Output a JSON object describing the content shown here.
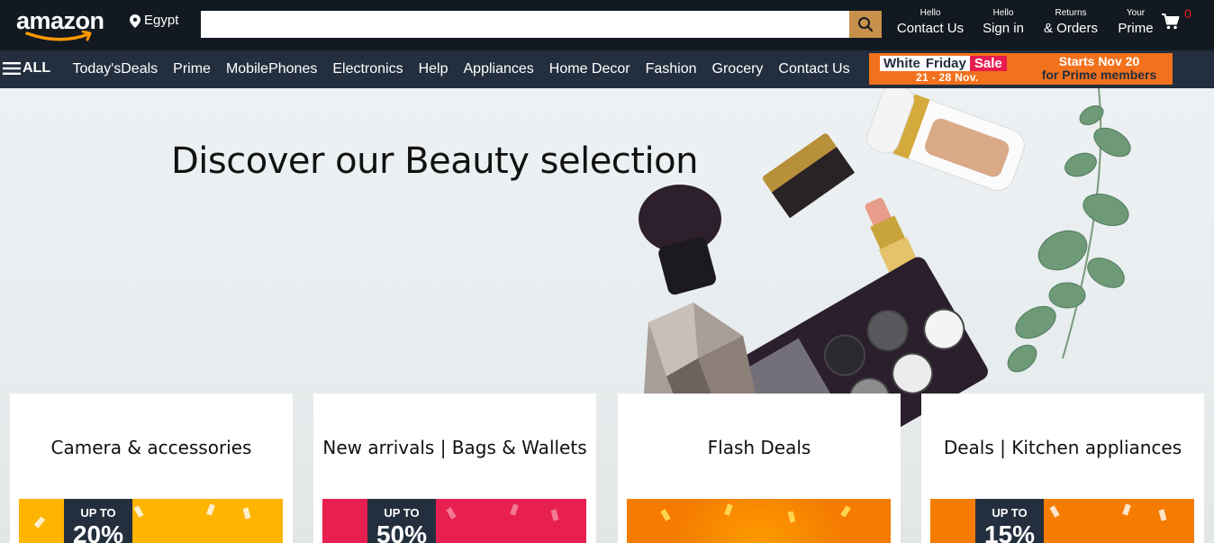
{
  "header": {
    "logo_text": "amazon",
    "location": "Egypt",
    "search": {
      "placeholder": "",
      "value": ""
    },
    "tools": [
      {
        "small": "Hello",
        "big": "Contact Us"
      },
      {
        "small": "Hello",
        "big": "Sign in"
      },
      {
        "small": "Returns",
        "big": "& Orders"
      },
      {
        "small": "Your",
        "big": "Prime"
      }
    ],
    "cart_count": "0"
  },
  "subnav": {
    "all_label": "ALL",
    "links": [
      "Today'sDeals",
      "Prime",
      "MobilePhones",
      "Electronics",
      "Help",
      "Appliances",
      "Home Decor",
      "Fashion",
      "Grocery",
      "Contact Us"
    ],
    "promo": {
      "word1": "White",
      "word2": "Friday",
      "word3": "Sale",
      "dates": "21 - 28 Nov.",
      "line1": "Starts Nov 20",
      "line2": "for Prime members"
    }
  },
  "hero": {
    "title": "Discover our Beauty selection"
  },
  "cards": [
    {
      "title": "Camera & accessories",
      "badge_top": "UP TO",
      "badge_pct": "20%",
      "color": "#ffb400"
    },
    {
      "title": "New arrivals | Bags & Wallets",
      "badge_top": "UP TO",
      "badge_pct": "50%",
      "color": "#e8204f"
    },
    {
      "title": "Flash Deals",
      "badge_top": "",
      "badge_pct": "",
      "color": "#f57c00"
    },
    {
      "title": "Deals | Kitchen appliances",
      "badge_top": "UP TO",
      "badge_pct": "15%",
      "color": "#f57c00"
    }
  ],
  "colors": {
    "header_bg": "#131921",
    "subnav_bg": "#232f3e",
    "search_button": "#c7904b",
    "promo_bg": "#f2711c",
    "cart_count": "#e81c1c"
  }
}
